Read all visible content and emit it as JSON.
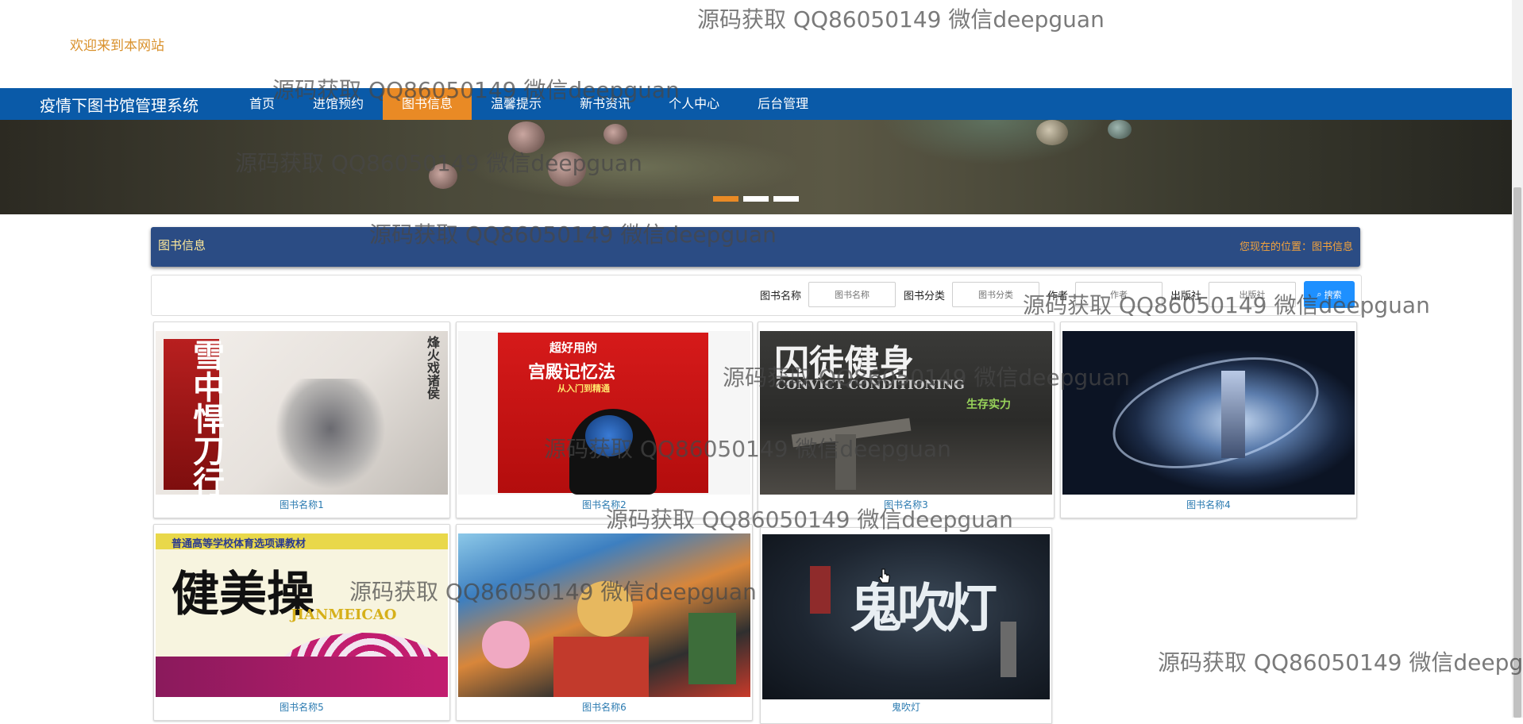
{
  "welcome": "欢迎来到本网站",
  "site_title": "疫情下图书馆管理系统",
  "nav": [
    {
      "label": "首页",
      "active": false
    },
    {
      "label": "进馆预约",
      "active": false
    },
    {
      "label": "图书信息",
      "active": true
    },
    {
      "label": "温馨提示",
      "active": false
    },
    {
      "label": "新书资讯",
      "active": false
    },
    {
      "label": "个人中心",
      "active": false
    },
    {
      "label": "后台管理",
      "active": false
    }
  ],
  "section": {
    "title": "图书信息",
    "breadcrumb": "您现在的位置：图书信息"
  },
  "search": {
    "name_label": "图书名称",
    "name_placeholder": "图书名称",
    "category_label": "图书分类",
    "category_placeholder": "图书分类",
    "author_label": "作者",
    "author_placeholder": "作者",
    "publisher_label": "出版社",
    "publisher_placeholder": "出版社",
    "button_label": "搜索"
  },
  "books": [
    {
      "title": "图书名称1",
      "cover_text": [
        "雪中悍刀行",
        "烽火戏诸侯"
      ]
    },
    {
      "title": "图书名称2",
      "cover_text": [
        "超好用的",
        "宫殿记忆法",
        "从入门到精通"
      ]
    },
    {
      "title": "图书名称3",
      "cover_text": [
        "囚徒健身",
        "CONVICT CONDITIONING",
        "生存实力"
      ]
    },
    {
      "title": "图书名称4",
      "cover_text": []
    },
    {
      "title": "图书名称5",
      "cover_text": [
        "普通高等学校体育选项课教材",
        "健美操",
        "JIANMEICAO"
      ]
    },
    {
      "title": "图书名称6",
      "cover_text": []
    },
    {
      "title": "鬼吹灯",
      "cover_text": [
        "鬼吹灯"
      ]
    }
  ],
  "watermark": "源码获取 QQ86050149 微信deepguan",
  "colors": {
    "navbar": "#0a5aa8",
    "nav_active": "#e98a25",
    "section_header": "#2b4c84",
    "search_button": "#1e90ff"
  }
}
